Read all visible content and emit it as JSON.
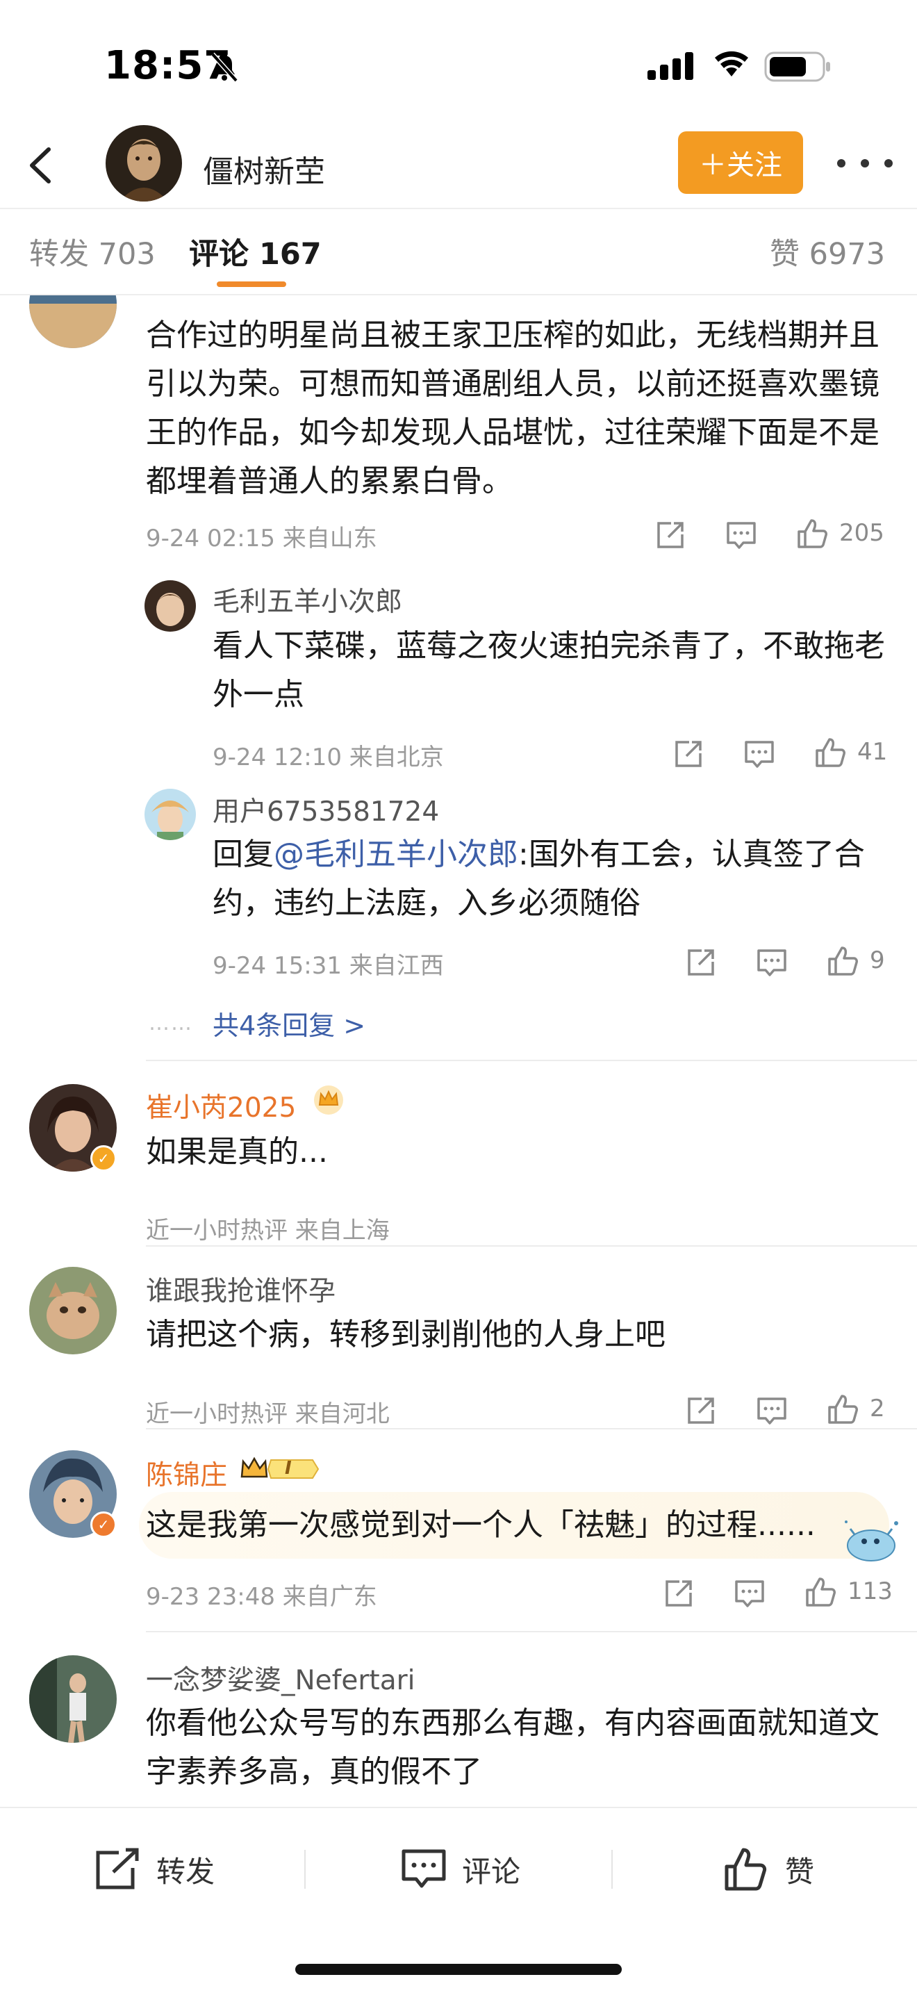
{
  "status": {
    "time": "18:57"
  },
  "nav": {
    "name": "僵树新茔",
    "follow_label": "＋关注"
  },
  "tabs": [
    {
      "label": "转发 703"
    },
    {
      "label": "评论 167"
    },
    {
      "label": "赞 6973"
    }
  ],
  "comments": {
    "c1": {
      "text": "合作过的明星尚且被王家卫压榨的如此，无线档期并且引以为荣。可想而知普通剧组人员，以前还挺喜欢墨镜王的作品，如今却发现人品堪忧，过往荣耀下面是不是都埋着普通人的累累白骨。",
      "meta": "9-24 02:15  来自山东",
      "likes": "205"
    },
    "r1": {
      "name": "毛利五羊小次郎",
      "text": "看人下菜碟，蓝莓之夜火速拍完杀青了，不敢拖老外一点",
      "meta": "9-24 12:10  来自北京",
      "likes": "41"
    },
    "r2": {
      "name": "用户6753581724",
      "text_prefix": "回复",
      "mention": "@毛利五羊小次郎",
      "text": ":国外有工会，认真签了合约，违约上法庭，入乡必须随俗",
      "meta": "9-24 15:31  来自江西",
      "likes": "9"
    },
    "more_replies": "共4条回复 >",
    "dots": "……",
    "c2": {
      "name": "崔小芮2025",
      "text": "如果是真的...",
      "meta": "近一小时热评  来自上海"
    },
    "c3": {
      "name": "谁跟我抢谁怀孕",
      "text": "请把这个病，转移到剥削他的人身上吧",
      "meta": "近一小时热评  来自河北",
      "likes": "2"
    },
    "c4": {
      "name": "陈锦庄",
      "badge": "I",
      "text": "这是我第一次感觉到对一个人「祛魅」的过程......",
      "meta": "9-23 23:48  来自广东",
      "likes": "113"
    },
    "c5": {
      "name": "一念梦娑婆_Nefertari",
      "text": "你看他公众号写的东西那么有趣，有内容画面就知道文字素养多高，真的假不了"
    }
  },
  "bottom": {
    "repost": "转发",
    "comment": "评论",
    "like": "赞"
  },
  "colors": {
    "accent": "#f39b22",
    "tab_underline": "#f08a2b",
    "link": "#3d5fa8",
    "vip_name": "#e8742b"
  },
  "icons": [
    "bell-slash-icon",
    "signal-icon",
    "wifi-icon",
    "battery-icon",
    "back-icon",
    "more-icon",
    "share-icon",
    "comment-icon",
    "like-icon",
    "crown-icon",
    "verified-icon"
  ]
}
